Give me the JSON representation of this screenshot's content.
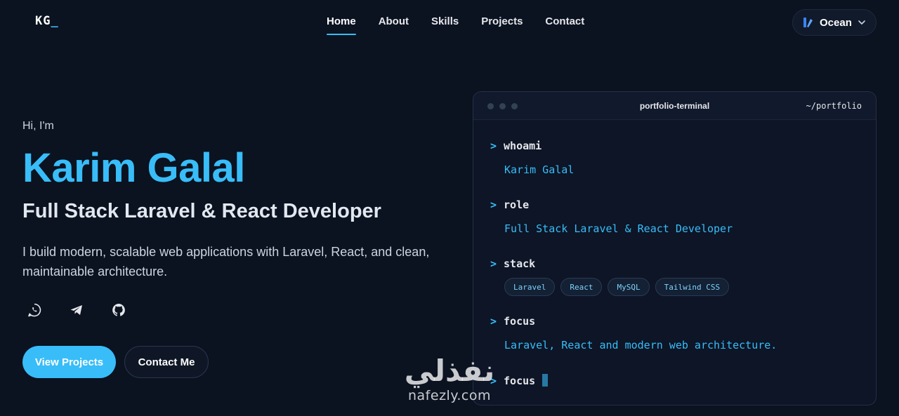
{
  "header": {
    "logo": "KG",
    "logo_cursor": "_",
    "nav": [
      {
        "label": "Home",
        "active": true
      },
      {
        "label": "About",
        "active": false
      },
      {
        "label": "Skills",
        "active": false
      },
      {
        "label": "Projects",
        "active": false
      },
      {
        "label": "Contact",
        "active": false
      }
    ],
    "theme": {
      "label": "Ocean",
      "icon": "palette-icon"
    }
  },
  "hero": {
    "greeting": "Hi, I'm",
    "name": "Karim Galal",
    "role": "Full Stack Laravel & React Developer",
    "description": "I build modern, scalable web applications with Laravel, React, and clean, maintainable architecture.",
    "socials": [
      {
        "name": "whatsapp-icon"
      },
      {
        "name": "telegram-icon"
      },
      {
        "name": "github-icon"
      }
    ],
    "primary_button": "View Projects",
    "secondary_button": "Contact Me"
  },
  "terminal": {
    "title": "portfolio-terminal",
    "path": "~/portfolio",
    "prompt": ">",
    "entries": [
      {
        "command": "whoami",
        "output": "Karim Galal"
      },
      {
        "command": "role",
        "output": "Full Stack Laravel & React Developer"
      },
      {
        "command": "stack",
        "tags": [
          "Laravel",
          "React",
          "MySQL",
          "Tailwind CSS"
        ]
      },
      {
        "command": "focus",
        "output": "Laravel, React and modern web architecture."
      }
    ],
    "typing": "focus"
  },
  "watermark": {
    "arabic": "نفذلي",
    "latin": "nafezly.com"
  },
  "colors": {
    "accent": "#38bdf8",
    "background": "#0b1220"
  }
}
